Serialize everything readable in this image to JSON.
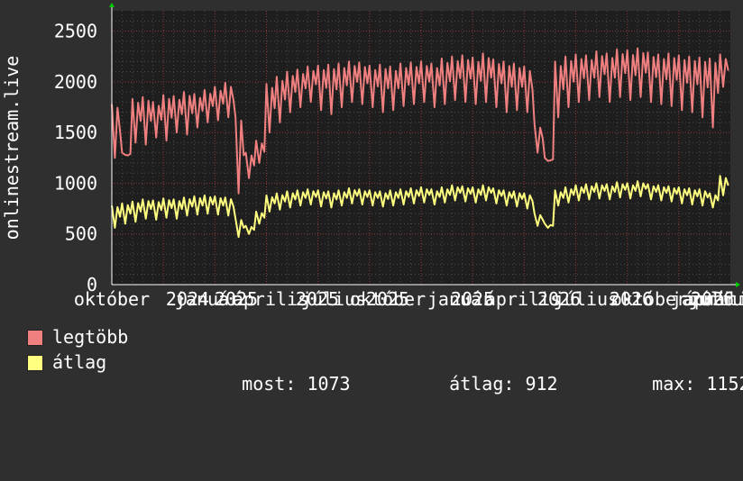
{
  "chart_data": {
    "type": "line",
    "ylabel": "onlinestream.live",
    "ylim": [
      0,
      2700
    ],
    "yticks": [
      0,
      500,
      1000,
      1500,
      2000,
      2500
    ],
    "xtick_labels": [
      "október",
      "január",
      "április",
      "július",
      "október",
      "január",
      "április",
      "július",
      "október",
      "január",
      "április",
      "július",
      "2024",
      "2025",
      "2025",
      "2025",
      "2025",
      "2026",
      "2026",
      "2026"
    ],
    "grid": true,
    "series": [
      {
        "name": "legtöbb",
        "color": "#f08080",
        "values": [
          1780,
          1300,
          1830,
          1850,
          1800,
          1870,
          1860,
          1900,
          1880,
          1920,
          1950,
          1990,
          1650,
          1300,
          1420,
          1980,
          2050,
          2100,
          2120,
          2150,
          2160,
          2170,
          2180,
          2200,
          2190,
          2160,
          2170,
          2150,
          2180,
          2190,
          2200,
          2180,
          2230,
          2250,
          2260,
          2240,
          2280,
          2220,
          2200,
          2180,
          2150,
          1580,
          1250,
          2200,
          2250,
          2270,
          2260,
          2300,
          2280,
          2320,
          2310,
          2330,
          2290,
          2270,
          2280,
          2260,
          2250,
          2240,
          2230,
          2270
        ],
        "min": [
          1250,
          1280,
          1400,
          1380,
          1450,
          1420,
          1500,
          1480,
          1550,
          1600,
          1620,
          1650,
          900,
          1050,
          1200,
          1500,
          1600,
          1700,
          1750,
          1800,
          1720,
          1680,
          1750,
          1800,
          1780,
          1750,
          1700,
          1720,
          1760,
          1780,
          1800,
          1750,
          1780,
          1820,
          1800,
          1780,
          1800,
          1750,
          1700,
          1720,
          1700,
          1300,
          1220,
          1650,
          1750,
          1800,
          1820,
          1850,
          1800,
          1850,
          1820,
          1850,
          1800,
          1780,
          1760,
          1720,
          1700,
          1650,
          1550,
          1950
        ]
      },
      {
        "name": "átlag",
        "color": "#ffff80",
        "values": [
          780,
          800,
          820,
          840,
          830,
          850,
          840,
          860,
          870,
          880,
          870,
          860,
          650,
          580,
          720,
          880,
          900,
          920,
          930,
          940,
          930,
          920,
          930,
          950,
          940,
          930,
          920,
          930,
          940,
          950,
          960,
          940,
          960,
          980,
          970,
          960,
          980,
          950,
          930,
          920,
          900,
          700,
          600,
          930,
          960,
          980,
          990,
          1000,
          990,
          1010,
          1000,
          1020,
          990,
          980,
          970,
          960,
          950,
          940,
          900,
          1073
        ],
        "min": [
          560,
          600,
          620,
          650,
          640,
          660,
          650,
          680,
          690,
          700,
          690,
          680,
          470,
          500,
          600,
          720,
          740,
          760,
          780,
          790,
          770,
          760,
          780,
          800,
          790,
          780,
          770,
          780,
          790,
          800,
          810,
          790,
          810,
          830,
          820,
          810,
          830,
          800,
          780,
          770,
          750,
          580,
          560,
          780,
          810,
          830,
          840,
          850,
          840,
          860,
          850,
          870,
          840,
          830,
          820,
          800,
          790,
          780,
          760,
          880
        ]
      }
    ],
    "legend": {
      "max_label": "legtöbb",
      "avg_label": "átlag",
      "stats": [
        {
          "label": "most:",
          "value": "1073"
        },
        {
          "label": "átlag:",
          "value": "912"
        },
        {
          "label": "max:",
          "value": "1152"
        }
      ]
    }
  }
}
